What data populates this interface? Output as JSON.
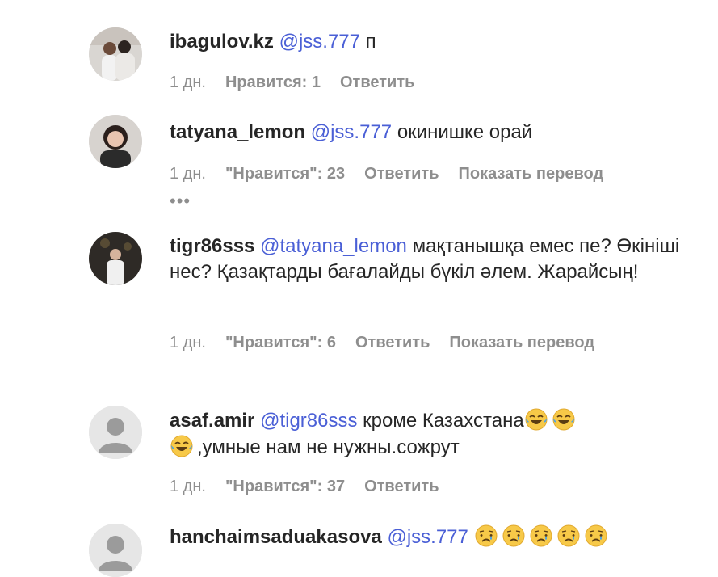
{
  "comments": [
    {
      "username": "ibagulov.kz",
      "mention": "@jss.777",
      "text": "п",
      "time": "1 дн.",
      "likes": "Нравится: 1",
      "reply": "Ответить"
    },
    {
      "username": "tatyana_lemon",
      "mention": "@jss.777",
      "text": "окинишке орай",
      "time": "1 дн.",
      "likes": "\"Нравится\": 23",
      "reply": "Ответить",
      "translate": "Показать перевод",
      "more": "•••"
    },
    {
      "username": "tigr86sss",
      "mention": "@tatyana_lemon",
      "text": "мақтанышқа емес пе? Өкініші нес? Қазақтарды бағалайды бүкіл әлем. Жарайсың!",
      "time": "1 дн.",
      "likes": "\"Нравится\": 6",
      "reply": "Ответить",
      "translate": "Показать перевод"
    },
    {
      "username": "asaf.amir",
      "mention": "@tigr86sss",
      "text": "кроме Казахстана",
      "text2": ",умные нам не нужны.сожрут",
      "emoji_line1": [
        "laughing-tears",
        "laughing-tears"
      ],
      "emoji_line2": [
        "laughing-tears"
      ],
      "time": "1 дн.",
      "likes": "\"Нравится\": 37",
      "reply": "Ответить"
    },
    {
      "username": "hanchaimsaduakasova",
      "mention": "@jss.777",
      "emojis": [
        "crying-face",
        "crying-face",
        "crying-face",
        "crying-face",
        "crying-face"
      ]
    }
  ],
  "colors": {
    "mention": "#4a5fd6",
    "meta": "#8e8e8e",
    "text": "#262626",
    "emoji_yellow": "#f7c948"
  }
}
